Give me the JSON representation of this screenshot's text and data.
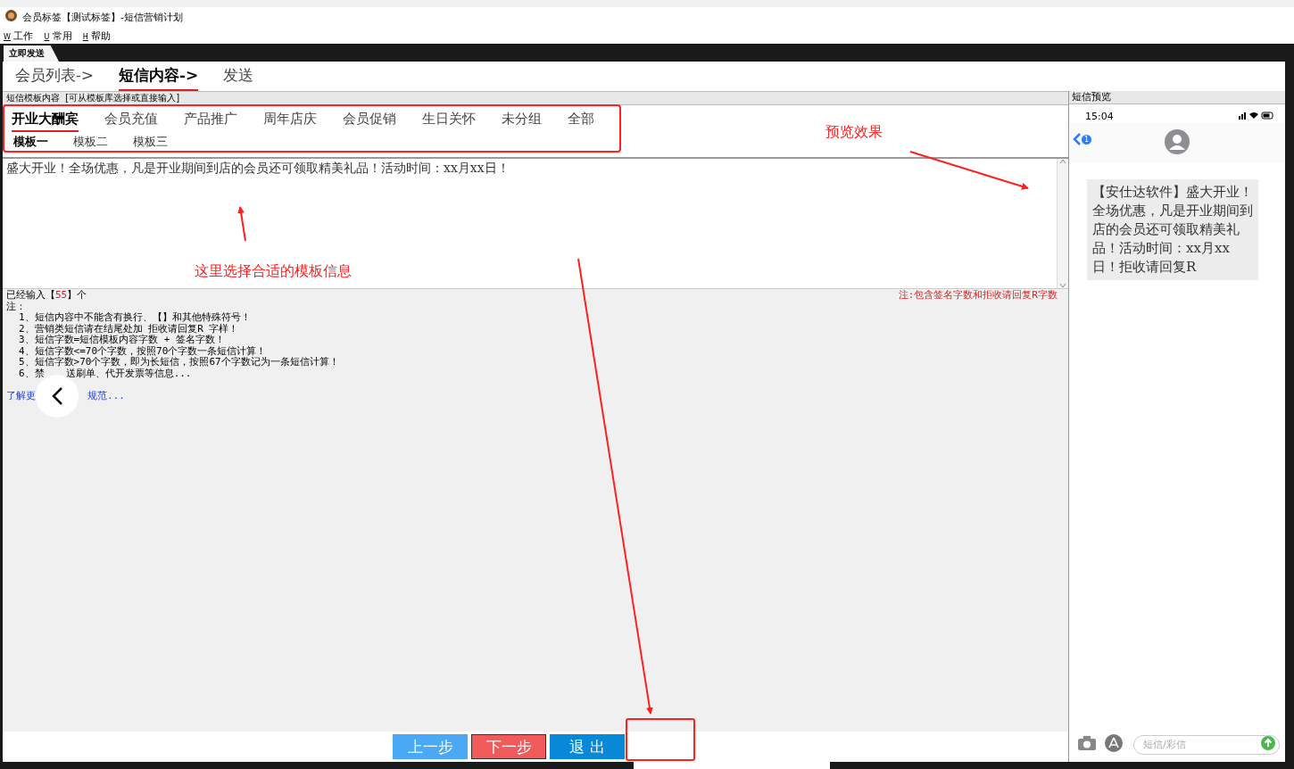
{
  "window": {
    "title": "会员标签【测试标签】-短信营销计划"
  },
  "menu": [
    {
      "key": "W",
      "label": "工作"
    },
    {
      "key": "U",
      "label": "常用"
    },
    {
      "key": "H",
      "label": "帮助"
    }
  ],
  "doc_tab": {
    "label": "立即发送",
    "selected": true
  },
  "steps": [
    {
      "label": "会员列表->",
      "selected": false
    },
    {
      "label": "短信内容->",
      "selected": true
    },
    {
      "label": "发送",
      "selected": false
    }
  ],
  "template_panel": {
    "header": "短信模板内容  [可从模板库选择或直接输入]",
    "categories": [
      {
        "label": "开业大酬宾",
        "selected": true
      },
      {
        "label": "会员充值",
        "selected": false
      },
      {
        "label": "产品推广",
        "selected": false
      },
      {
        "label": "周年店庆",
        "selected": false
      },
      {
        "label": "会员促销",
        "selected": false
      },
      {
        "label": "生日关怀",
        "selected": false
      },
      {
        "label": "未分组",
        "selected": false
      },
      {
        "label": "全部",
        "selected": false
      }
    ],
    "templates": [
      {
        "label": "模板一",
        "selected": true
      },
      {
        "label": "模板二",
        "selected": false
      },
      {
        "label": "模板三",
        "selected": false
      }
    ],
    "message": "盛大开业！全场优惠，凡是开业期间到店的会员还可领取精美礼品！活动时间：xx月xx日！"
  },
  "counter": {
    "prefix": "已经输入【",
    "count": "55",
    "suffix": "】个"
  },
  "count_note": "注:包含签名字数和拒收请回复R字数",
  "notes_title": "注：",
  "notes": [
    [
      "1、短信内容中不能含有换行、【】和其他特殊符号！"
    ],
    [
      "2、营销类短信请在结尾处加 拒收请回复R 字样！"
    ],
    [
      "3、短信字数=短信模板内容字数 + 签名字数！"
    ],
    [
      "4、短信字数<=70个字数，按照70个字数一条短信计算！"
    ],
    [
      "5、短信字数>70个字数，即为长短信，按照67个字数记为一条短信计算！"
    ],
    [
      "6、禁",
      "送刷单、代开发票等信息..."
    ]
  ],
  "more_link": [
    "了解更",
    "规范..."
  ],
  "buttons": [
    {
      "label": "上一步",
      "kind": "prev"
    },
    {
      "label": "下一步",
      "kind": "next"
    },
    {
      "label": "退  出",
      "kind": "exit"
    }
  ],
  "preview": {
    "header": "短信预览",
    "time": "15:04",
    "unread": "1",
    "bubble": "【安仕达软件】盛大开业！全场优惠，凡是开业期间到店的会员还可领取精美礼品！活动时间：xx月xx日！拒收请回复R",
    "input_placeholder": "短信/彩信"
  },
  "annotations": [
    {
      "text": "预览效果"
    },
    {
      "text": "这里选择合适的模板信息"
    }
  ]
}
